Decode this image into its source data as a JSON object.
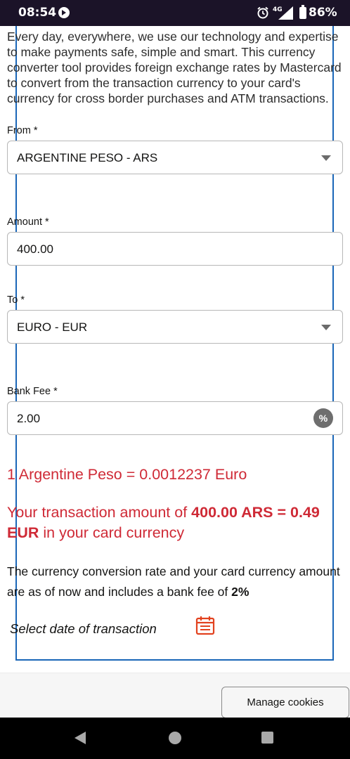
{
  "status_bar": {
    "time": "08:54",
    "network": "4G",
    "battery": "86%"
  },
  "intro_text": "Every day, everywhere, we use our technology and expertise to make payments safe, simple and smart. This currency converter tool provides foreign exchange rates by Mastercard to convert from the transaction currency to your card's currency for cross border purchases and ATM transactions.",
  "form": {
    "from_label": "From *",
    "from_value": "ARGENTINE PESO - ARS",
    "amount_label": "Amount *",
    "amount_value": "400.00",
    "to_label": "To *",
    "to_value": "EURO - EUR",
    "fee_label": "Bank Fee *",
    "fee_value": "2.00",
    "fee_unit": "%"
  },
  "result": {
    "rate_text": "1 Argentine Peso = 0.0012237 Euro",
    "txn_prefix": "Your transaction amount of ",
    "txn_from": "400.00 ARS",
    "txn_equals": " = ",
    "txn_to": "0.49 EUR",
    "txn_suffix": " in your card currency",
    "note_prefix": "The currency conversion rate and your card currency amount are as of ",
    "note_now": "now",
    "note_middle": " and includes a bank fee of ",
    "note_fee": "2%"
  },
  "date_link": "Select date of transaction",
  "cookie_button": "Manage cookies",
  "colors": {
    "accent_red": "#cf2a36",
    "frame_blue": "#1a66b8",
    "status_bar": "#1b1328",
    "calendar": "#e2421f"
  }
}
